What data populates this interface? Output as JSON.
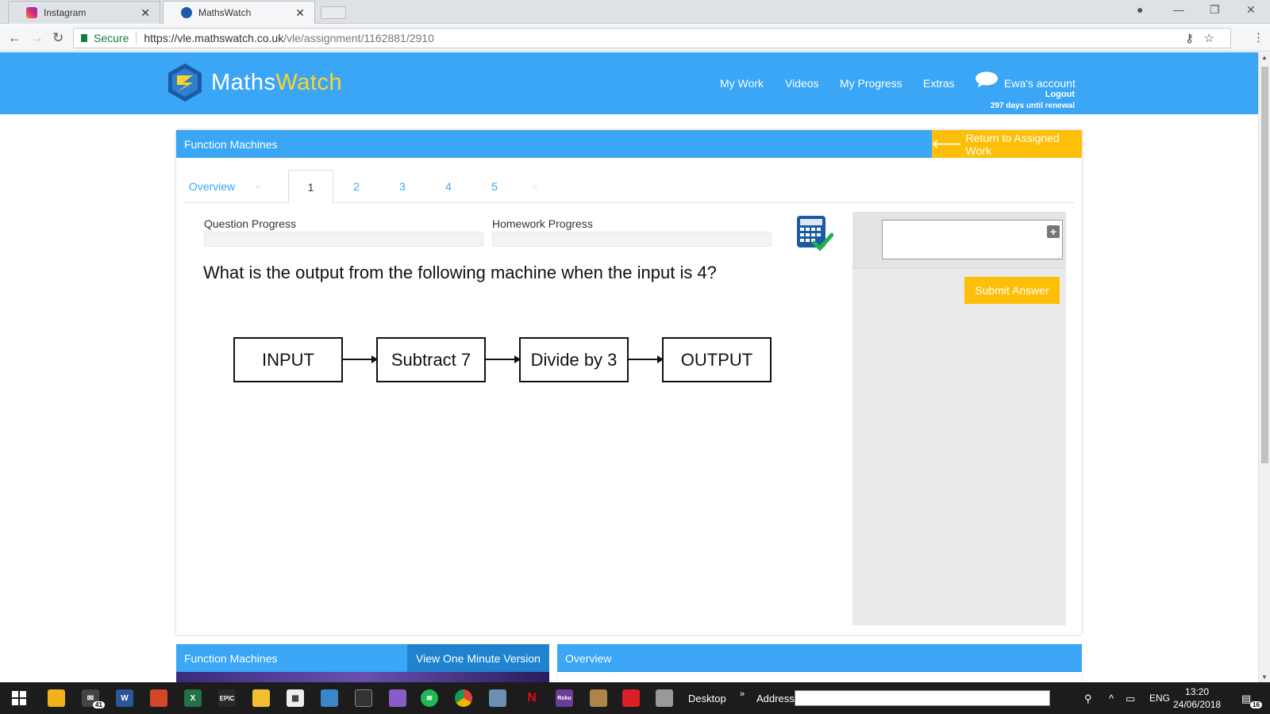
{
  "browser": {
    "tabs": [
      {
        "title": "Instagram",
        "icon": "instagram-icon"
      },
      {
        "title": "MathsWatch",
        "icon": "mathswatch-icon",
        "active": true
      }
    ],
    "secure_label": "Secure",
    "url_host": "https://vle.mathswatch.co.uk",
    "url_path": "/vle/assignment/1162881/2910"
  },
  "site": {
    "logo": {
      "maths": "Maths",
      "watch": "Watch"
    },
    "nav": [
      "My Work",
      "Videos",
      "My Progress",
      "Extras"
    ],
    "account_name": "Ewa's account",
    "logout": "Logout",
    "renewal": "297 days until renewal",
    "colors": {
      "primary": "#3aa6f5",
      "accent": "#fdbf07",
      "logo_yellow": "#ffd42a"
    }
  },
  "panel": {
    "title": "Function Machines",
    "return_label": "Return to Assigned Work",
    "tabs": {
      "overview": "Overview",
      "prev": "«",
      "next": "»",
      "items": [
        "1",
        "2",
        "3",
        "4",
        "5"
      ],
      "active": "1"
    },
    "question_progress_label": "Question Progress",
    "homework_progress_label": "Homework Progress",
    "question_progress": 0,
    "homework_progress": 0,
    "question": "What is the output from the following machine when the input is 4?",
    "machine": [
      "INPUT",
      "Subtract 7",
      "Divide by 3",
      "OUTPUT"
    ],
    "answer_value": "",
    "submit_label": "Submit Answer"
  },
  "lower": {
    "video_title": "Function Machines",
    "one_minute_label": "View One Minute Version",
    "overview_title": "Overview"
  },
  "taskbar": {
    "desktop_label": "Desktop",
    "address_label": "Address",
    "language": "ENG",
    "time": "13:20",
    "date": "24/06/2018",
    "mail_badge": "41",
    "notification_badge": "16"
  }
}
